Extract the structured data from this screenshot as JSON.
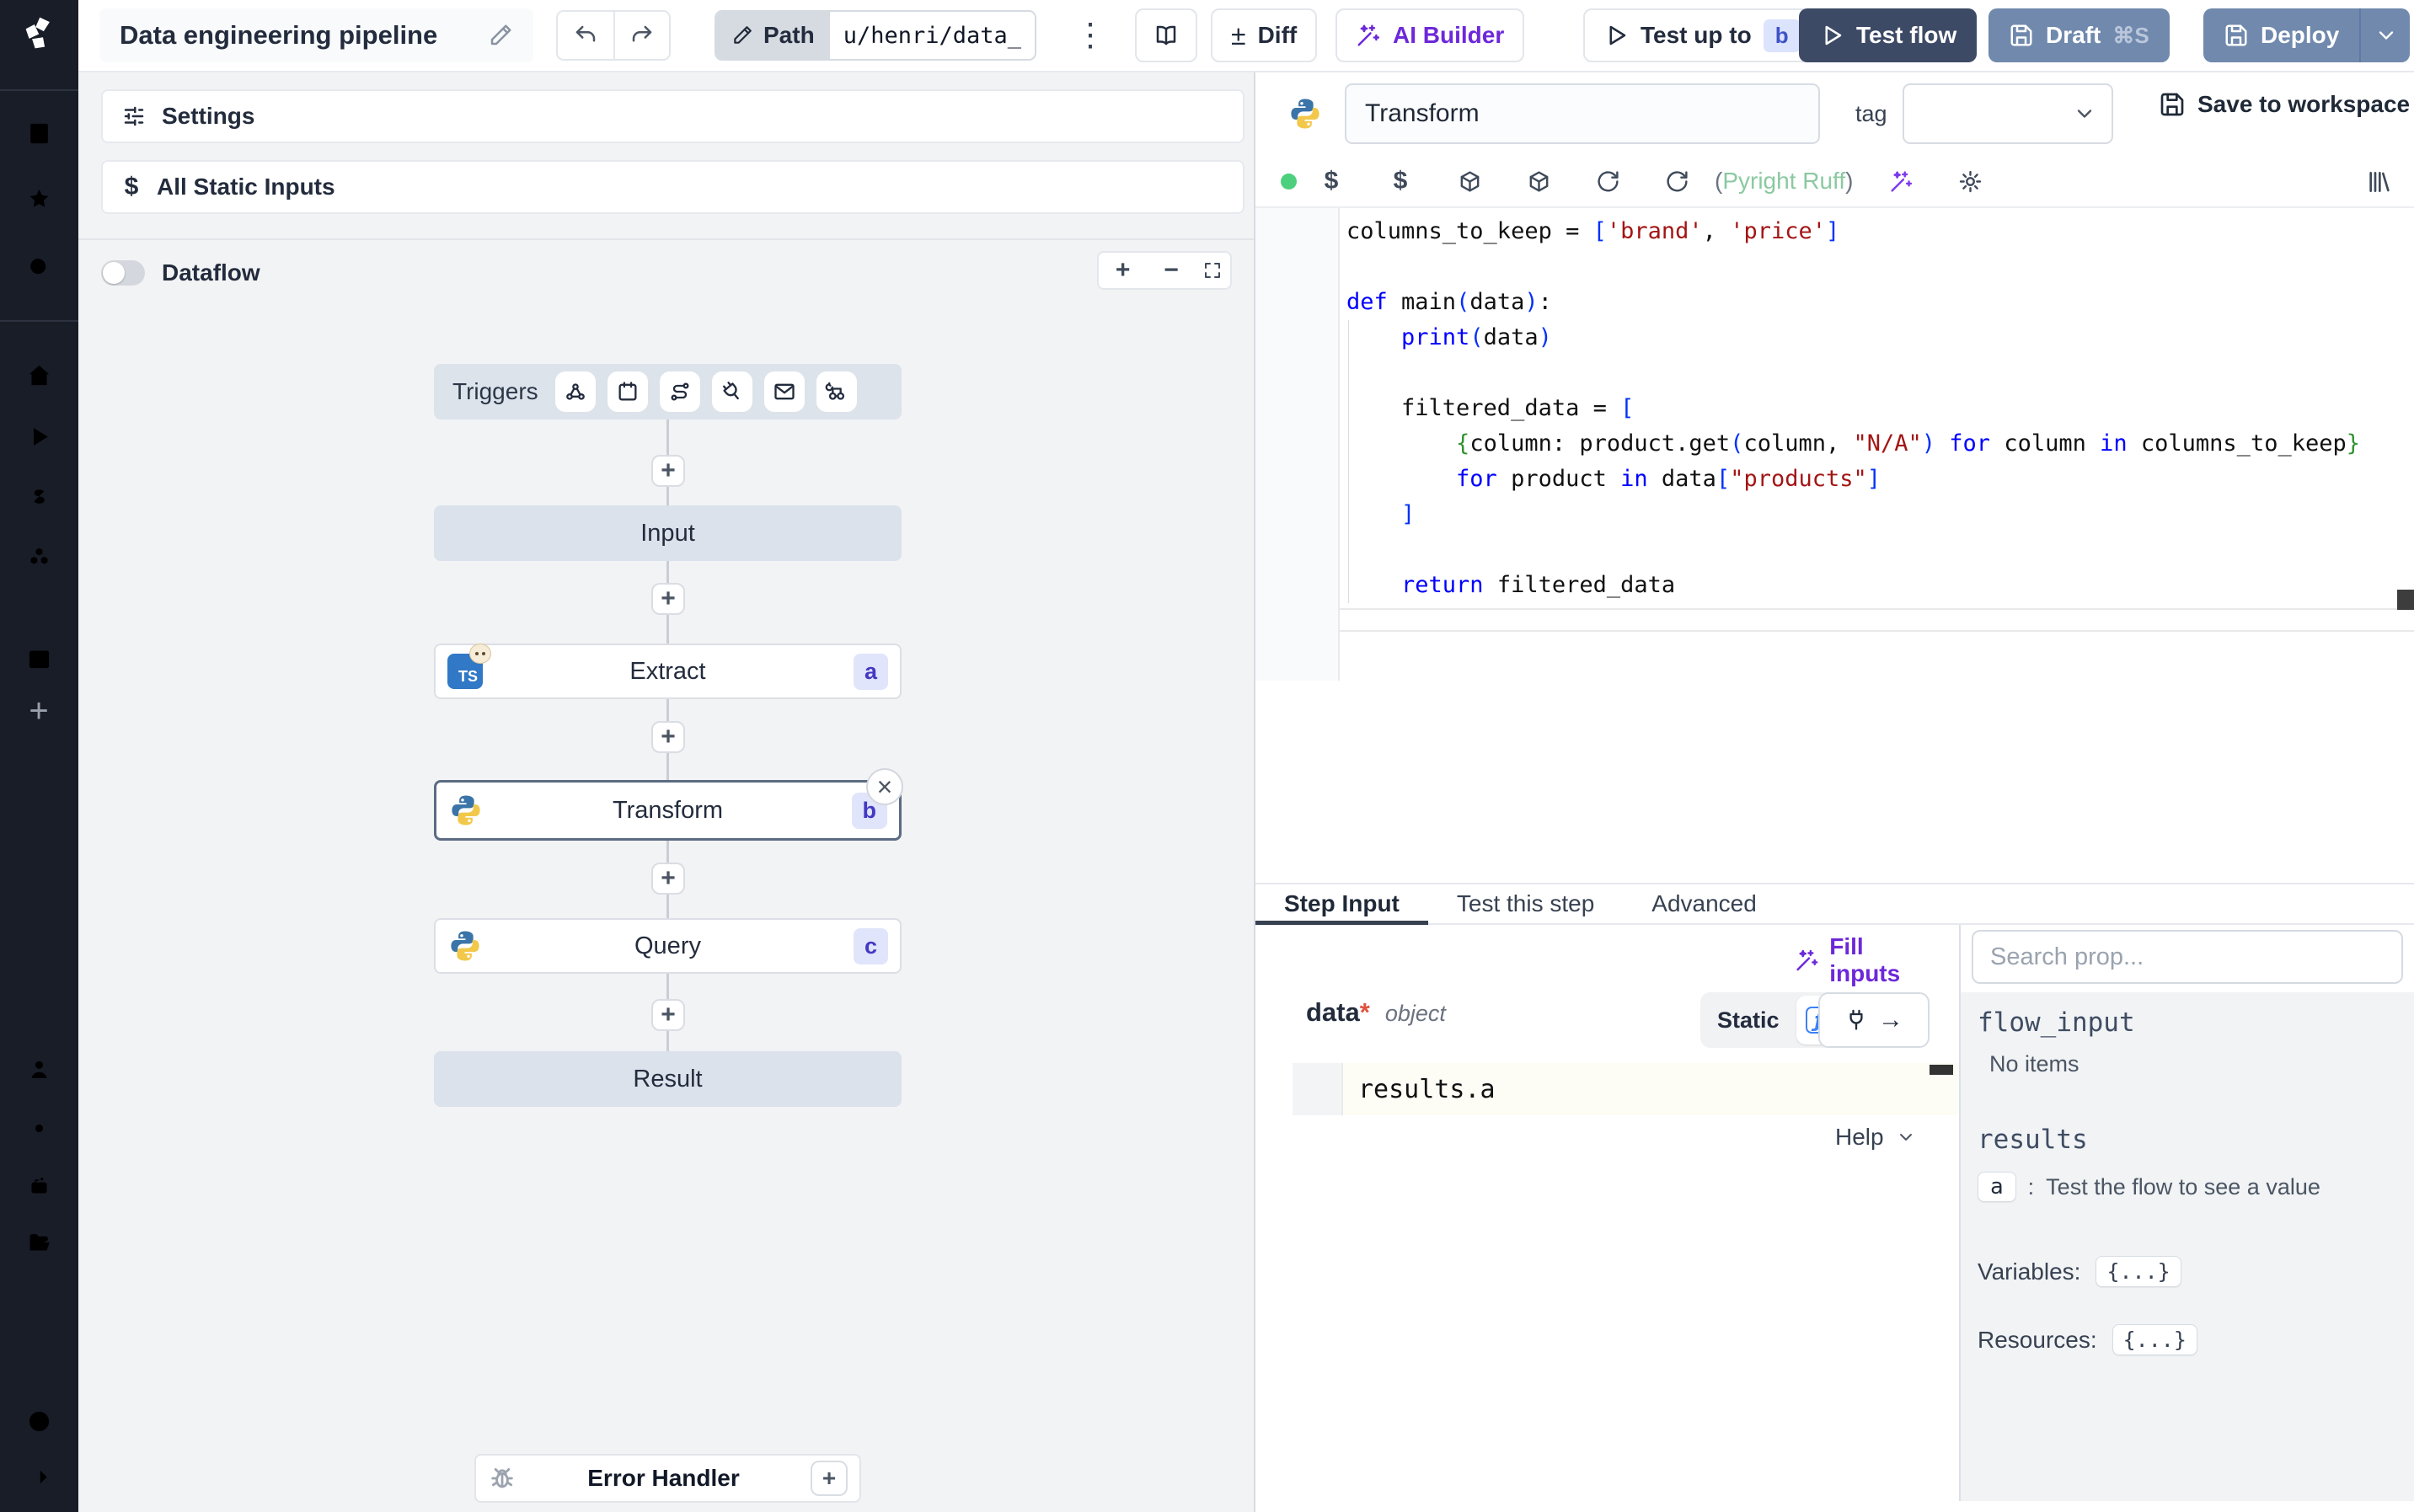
{
  "topbar": {
    "title": "Data engineering pipeline",
    "path_label": "Path",
    "path_value": "u/henri/data_",
    "kebab": "⋮",
    "diff_sign": "±",
    "diff_label": "Diff",
    "ai_builder_label": "AI Builder",
    "test_up_to_label": "Test up to",
    "test_up_to_badge": "b",
    "test_flow_label": "Test flow",
    "draft_label": "Draft",
    "draft_shortcut": "⌘S",
    "deploy_label": "Deploy"
  },
  "flow": {
    "settings_label": "Settings",
    "static_inputs_icon": "$",
    "static_inputs_label": "All Static Inputs",
    "dataflow_label": "Dataflow",
    "zoom_in": "+",
    "zoom_out": "−",
    "triggers_label": "Triggers",
    "connector_plus": "+",
    "input_label": "Input",
    "extract_lang": "TS",
    "extract_label": "Extract",
    "extract_badge": "a",
    "transform_label": "Transform",
    "transform_badge": "b",
    "close_x": "×",
    "query_label": "Query",
    "query_badge": "c",
    "result_label": "Result",
    "error_handler_label": "Error Handler",
    "error_handler_plus": "+"
  },
  "editor": {
    "step_name": "Transform",
    "tag_label": "tag",
    "save_label": "Save to workspace",
    "dollar_icon": "$",
    "lint_open": "(",
    "lint_name": "Pyright Ruff",
    "lint_close": ")",
    "code": {
      "lines": [
        [
          {
            "c": "p",
            "t": "columns_to_keep = "
          },
          {
            "c": "b",
            "t": "["
          },
          {
            "c": "s",
            "t": "'brand'"
          },
          {
            "c": "p",
            "t": ", "
          },
          {
            "c": "s",
            "t": "'price'"
          },
          {
            "c": "b",
            "t": "]"
          }
        ],
        [],
        [
          {
            "c": "k",
            "t": "def"
          },
          {
            "c": "p",
            "t": " main"
          },
          {
            "c": "b",
            "t": "("
          },
          {
            "c": "p",
            "t": "data"
          },
          {
            "c": "b",
            "t": ")"
          },
          {
            "c": "p",
            "t": ":"
          }
        ],
        [
          {
            "c": "p",
            "t": "    "
          },
          {
            "c": "k",
            "t": "print"
          },
          {
            "c": "b",
            "t": "("
          },
          {
            "c": "p",
            "t": "data"
          },
          {
            "c": "b",
            "t": ")"
          }
        ],
        [],
        [
          {
            "c": "p",
            "t": "    filtered_data = "
          },
          {
            "c": "b",
            "t": "["
          }
        ],
        [
          {
            "c": "p",
            "t": "        "
          },
          {
            "c": "g",
            "t": "{"
          },
          {
            "c": "p",
            "t": "column: product.get"
          },
          {
            "c": "b",
            "t": "("
          },
          {
            "c": "p",
            "t": "column, "
          },
          {
            "c": "s",
            "t": "\"N/A\""
          },
          {
            "c": "b",
            "t": ")"
          },
          {
            "c": "p",
            "t": " "
          },
          {
            "c": "k",
            "t": "for"
          },
          {
            "c": "p",
            "t": " column "
          },
          {
            "c": "k",
            "t": "in"
          },
          {
            "c": "p",
            "t": " columns_to_keep"
          },
          {
            "c": "g",
            "t": "}"
          }
        ],
        [
          {
            "c": "p",
            "t": "        "
          },
          {
            "c": "k",
            "t": "for"
          },
          {
            "c": "p",
            "t": " product "
          },
          {
            "c": "k",
            "t": "in"
          },
          {
            "c": "p",
            "t": " data"
          },
          {
            "c": "b",
            "t": "["
          },
          {
            "c": "s",
            "t": "\"products\""
          },
          {
            "c": "b",
            "t": "]"
          }
        ],
        [
          {
            "c": "p",
            "t": "    "
          },
          {
            "c": "b",
            "t": "]"
          }
        ],
        [],
        [
          {
            "c": "p",
            "t": "    "
          },
          {
            "c": "k",
            "t": "return"
          },
          {
            "c": "p",
            "t": " filtered_data"
          }
        ]
      ]
    }
  },
  "bottom": {
    "tabs": [
      "Step Input",
      "Test this step",
      "Advanced"
    ],
    "fill_inputs_label": "Fill inputs",
    "field_name": "data",
    "field_required": "*",
    "field_type": "object",
    "static_label": "Static",
    "fn_icon": "ƒ",
    "plug_arrow": "→",
    "expr_value": "results.a",
    "help_label": "Help"
  },
  "props": {
    "search_placeholder": "Search prop...",
    "flow_input": "flow_input",
    "no_items": "No items",
    "results": "results",
    "result_key": "a",
    "result_sep": ":",
    "result_hint": "Test the flow to see a value",
    "variables_label": "Variables:",
    "variables_value": "{...}",
    "resources_label": "Resources:",
    "resources_value": "{...}"
  }
}
